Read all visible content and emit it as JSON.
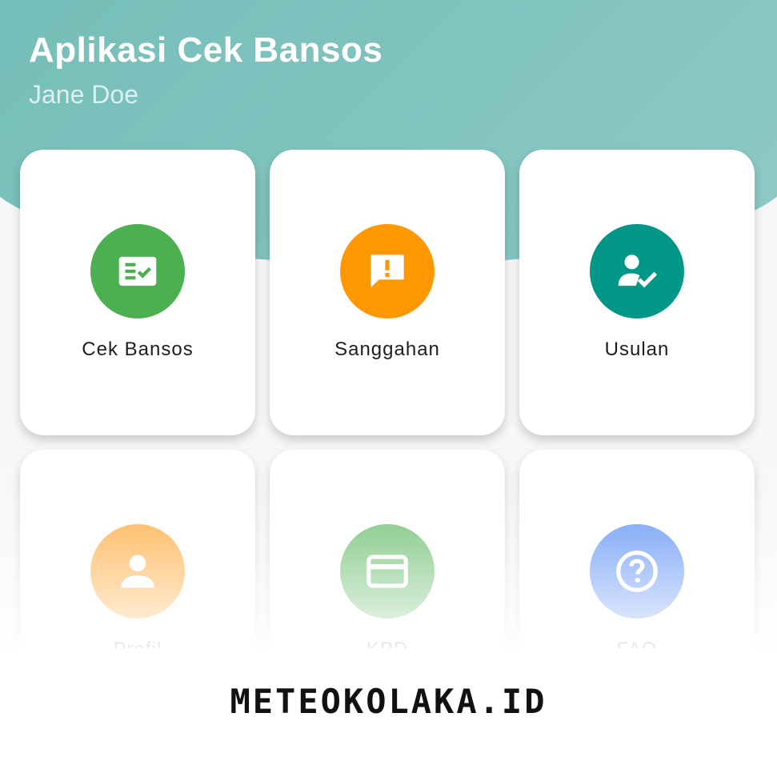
{
  "header": {
    "title": "Aplikasi Cek Bansos",
    "user_name": "Jane Doe"
  },
  "menu": [
    {
      "label": "Cek Bansos",
      "icon": "checklist-icon",
      "color": "#4caf50"
    },
    {
      "label": "Sanggahan",
      "icon": "feedback-alert-icon",
      "color": "#ff9800"
    },
    {
      "label": "Usulan",
      "icon": "user-check-icon",
      "color": "#009688"
    },
    {
      "label": "Profil",
      "icon": "person-icon",
      "color": "#ffa93a"
    },
    {
      "label": "KPD",
      "icon": "credit-card-icon",
      "color": "#66bb6a"
    },
    {
      "label": "FAQ",
      "icon": "help-circle-icon",
      "color": "#5b8ff5"
    }
  ],
  "colors": {
    "header_teal": "#7ec1bd",
    "background": "#f7f7f7"
  },
  "watermark": "METEOKOLAKA.ID"
}
